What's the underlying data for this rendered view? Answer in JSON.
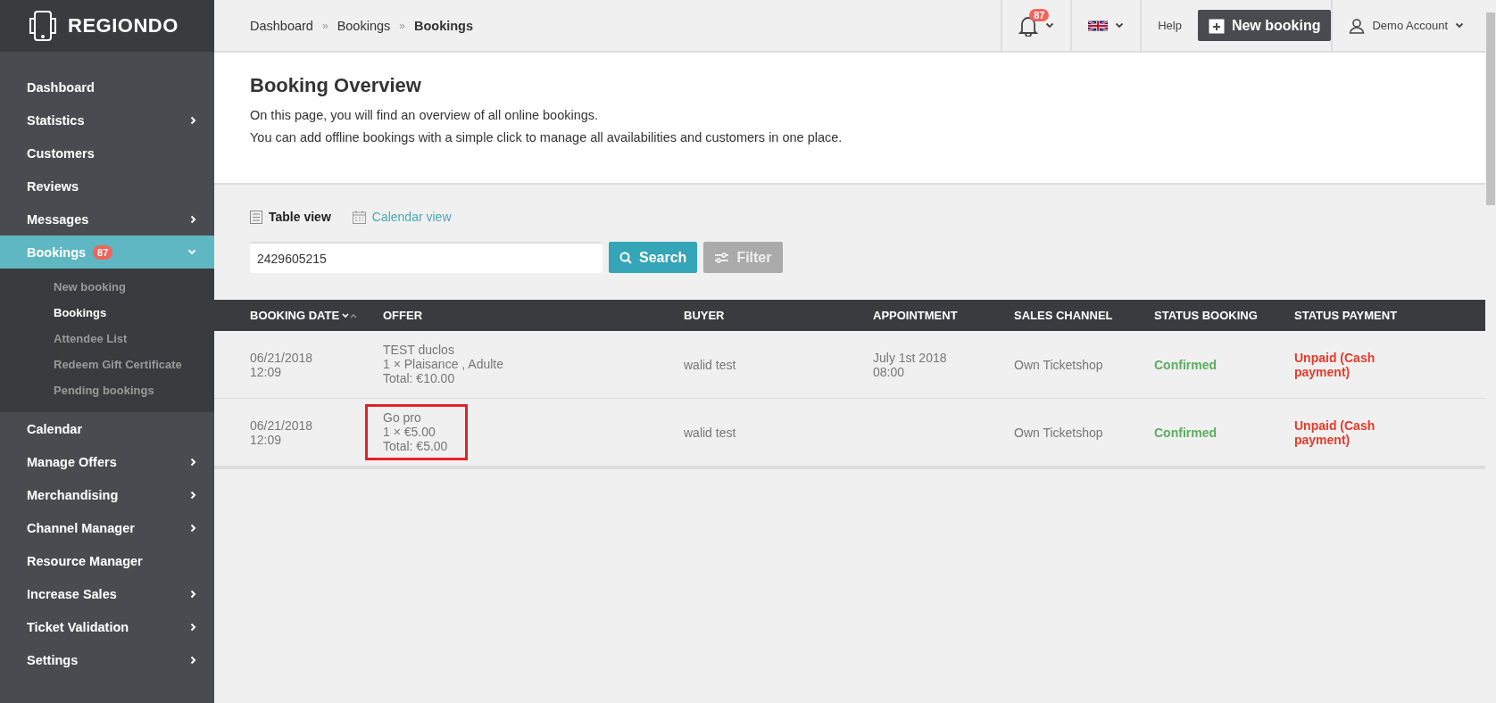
{
  "logo": {
    "text": "REGIONDO"
  },
  "breadcrumbs": [
    {
      "label": "Dashboard",
      "current": false
    },
    {
      "label": "Bookings",
      "current": false
    },
    {
      "label": "Bookings",
      "current": true
    }
  ],
  "breadcrumb_separator": "»",
  "topbar": {
    "notification_count": "87",
    "help": "Help",
    "new_booking": "New booking",
    "account": "Demo Account"
  },
  "sidebar": {
    "items": [
      {
        "label": "Dashboard",
        "selected": false,
        "has_submenu": false
      },
      {
        "label": "Statistics",
        "selected": false,
        "has_submenu": true
      },
      {
        "label": "Customers",
        "selected": false,
        "has_submenu": false
      },
      {
        "label": "Reviews",
        "selected": false,
        "has_submenu": false
      },
      {
        "label": "Messages",
        "selected": false,
        "has_submenu": true
      },
      {
        "label": "Bookings",
        "selected": true,
        "has_submenu": true,
        "expanded": true,
        "badge": "87",
        "children": [
          {
            "label": "New booking",
            "selected": false
          },
          {
            "label": "Bookings",
            "selected": true
          },
          {
            "label": "Attendee List",
            "selected": false
          },
          {
            "label": "Redeem Gift Certificate",
            "selected": false
          },
          {
            "label": "Pending bookings",
            "selected": false
          }
        ]
      },
      {
        "label": "Calendar",
        "selected": false,
        "has_submenu": false
      },
      {
        "label": "Manage Offers",
        "selected": false,
        "has_submenu": true
      },
      {
        "label": "Merchandising",
        "selected": false,
        "has_submenu": true
      },
      {
        "label": "Channel Manager",
        "selected": false,
        "has_submenu": true
      },
      {
        "label": "Resource Manager",
        "selected": false,
        "has_submenu": false
      },
      {
        "label": "Increase Sales",
        "selected": false,
        "has_submenu": true
      },
      {
        "label": "Ticket Validation",
        "selected": false,
        "has_submenu": true
      },
      {
        "label": "Settings",
        "selected": false,
        "has_submenu": true
      }
    ]
  },
  "page": {
    "title": "Booking Overview",
    "lines": [
      "On this page, you will find an overview of all online bookings.",
      "You can add offline bookings with a simple click to manage all availabilities and customers in one place."
    ]
  },
  "views": [
    {
      "label": "Table view",
      "selected": true,
      "kind": "table"
    },
    {
      "label": "Calendar view",
      "selected": false,
      "kind": "calendar"
    }
  ],
  "search": {
    "value": "2429605215",
    "button": "Search"
  },
  "filter": {
    "label": "Filter",
    "disabled": true
  },
  "table": {
    "columns": [
      {
        "label": "BOOKING DATE",
        "sortable": true
      },
      {
        "label": "OFFER",
        "sortable": false
      },
      {
        "label": "BUYER",
        "sortable": false
      },
      {
        "label": "APPOINTMENT",
        "sortable": false
      },
      {
        "label": "SALES CHANNEL",
        "sortable": false
      },
      {
        "label": "STATUS BOOKING",
        "sortable": false
      },
      {
        "label": "STATUS PAYMENT",
        "sortable": false
      }
    ],
    "rows": [
      {
        "booking_date": [
          "06/21/2018",
          "12:09"
        ],
        "offer": [
          "TEST duclos",
          "1 × Plaisance , Adulte",
          "Total: €10.00"
        ],
        "offer_highlighted": false,
        "buyer": "walid test",
        "appointment": [
          "July 1st 2018",
          "08:00"
        ],
        "sales_channel": "Own Ticketshop",
        "status_booking": "Confirmed",
        "status_payment": "Unpaid (Cash payment)"
      },
      {
        "booking_date": [
          "06/21/2018",
          "12:09"
        ],
        "offer": [
          "Go pro",
          "1 × €5.00",
          "Total: €5.00"
        ],
        "offer_highlighted": true,
        "buyer": "walid test",
        "appointment": [],
        "sales_channel": "Own Ticketshop",
        "status_booking": "Confirmed",
        "status_payment": "Unpaid (Cash payment)"
      }
    ]
  }
}
